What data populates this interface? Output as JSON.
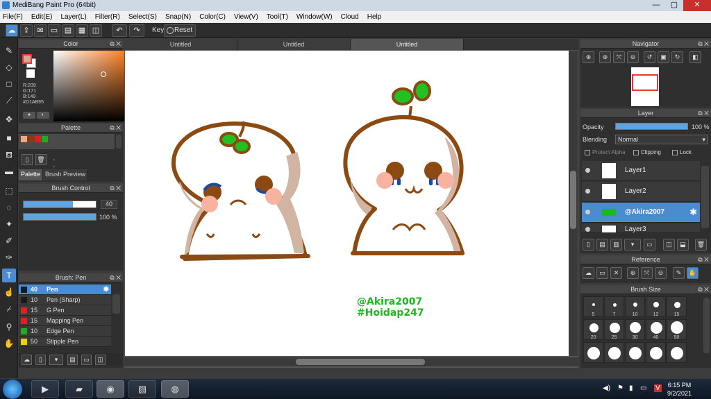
{
  "window": {
    "title": "MediBang Paint Pro (64bit)",
    "minimize": "—",
    "maximize": "▢",
    "close": "✕"
  },
  "menu": [
    "File(F)",
    "Edit(E)",
    "Layer(L)",
    "Filter(R)",
    "Select(S)",
    "Snap(N)",
    "Color(C)",
    "View(V)",
    "Tool(T)",
    "Window(W)",
    "Cloud",
    "Help"
  ],
  "toolbar": {
    "key_label": "Key",
    "reset_label": "Reset"
  },
  "color_panel": {
    "title": "Color",
    "r": "R:209",
    "g": "G:171",
    "b": "B:149",
    "hex": "#D1AB95",
    "foreground": "#D1AB95"
  },
  "palette_panel": {
    "title": "Palette",
    "name": "---",
    "tabs": [
      "Palette",
      "Brush Preview"
    ],
    "swatches": [
      "#f2a883",
      "#8a3b12",
      "#e02020",
      "#22aa22"
    ]
  },
  "brush_control": {
    "title": "Brush Control",
    "size_value": "40",
    "size_fraction": 0.68,
    "opacity_value": "100 %",
    "opacity_fraction": 1.0
  },
  "brush_list": {
    "title": "Brush: Pen",
    "items": [
      {
        "size": "40",
        "name": "Pen",
        "color": "#1a1a1a",
        "selected": true
      },
      {
        "size": "10",
        "name": "Pen (Sharp)",
        "color": "#1a1a1a"
      },
      {
        "size": "15",
        "name": "G Pen",
        "color": "#e02020"
      },
      {
        "size": "15",
        "name": "Mapping Pen",
        "color": "#e02020"
      },
      {
        "size": "10",
        "name": "Edge Pen",
        "color": "#22aa22"
      },
      {
        "size": "50",
        "name": "Stipple Pen",
        "color": "#f0d000"
      }
    ]
  },
  "canvas": {
    "tabs": [
      "Untitled",
      "Untitled",
      "Untitled"
    ],
    "active_tab": 2,
    "watermark_line1": "@Akira2007",
    "watermark_line2": "#Hoidap247"
  },
  "navigator": {
    "title": "Navigator"
  },
  "layer_panel": {
    "title": "Layer",
    "opacity_label": "Opacity",
    "opacity_value": "100 %",
    "blending_label": "Blending",
    "blending_value": "Normal",
    "protect_alpha": "Protect Alpha",
    "clipping": "Clipping",
    "lock": "Lock",
    "layers": [
      {
        "name": "Layer1",
        "selected": false
      },
      {
        "name": "Layer2",
        "selected": false
      },
      {
        "name": "@Akira2007",
        "selected": true
      },
      {
        "name": "Layer3",
        "selected": false
      }
    ]
  },
  "reference_panel": {
    "title": "Reference"
  },
  "brush_size_panel": {
    "title": "Brush Size",
    "sizes": [
      "5",
      "7",
      "10",
      "12",
      "15",
      "20",
      "25",
      "30",
      "40",
      "50",
      "",
      "",
      "",
      "",
      ""
    ]
  },
  "taskbar": {
    "time": "6:15 PM",
    "date": "9/2/2021"
  },
  "colors": {
    "accent": "#4a8ccf",
    "outline": "#8a4a12",
    "leaf": "#22c022",
    "watermark": "#1db820"
  }
}
